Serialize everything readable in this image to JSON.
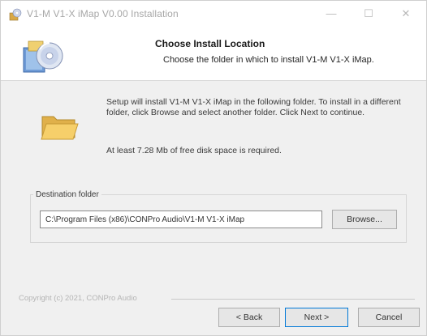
{
  "window": {
    "title": "V1-M V1-X iMap V0.00 Installation",
    "min_glyph": "—",
    "max_glyph": "☐",
    "close_glyph": "✕"
  },
  "header": {
    "title": "Choose Install Location",
    "subtitle": "Choose the folder in which to install V1-M V1-X iMap."
  },
  "body": {
    "intro": "Setup will install V1-M V1-X iMap in the following folder. To install in a different folder, click Browse and select another folder. Click Next to continue.",
    "space_required": "At least 7.28 Mb of free disk space is required.",
    "destination_label": "Destination folder",
    "destination_value": "C:\\Program Files (x86)\\CONPro Audio\\V1-M V1-X iMap",
    "browse_label": "Browse..."
  },
  "footer": {
    "copyright": "Copyright (c) 2021, CONPro Audio",
    "back_label": "< Back",
    "next_label": "Next >",
    "cancel_label": "Cancel"
  },
  "icons": {
    "app": "installer-icon",
    "header": "installer-cd-icon",
    "folder": "folder-icon"
  },
  "colors": {
    "folder": "#f4c85a",
    "accent": "#0078d7"
  }
}
